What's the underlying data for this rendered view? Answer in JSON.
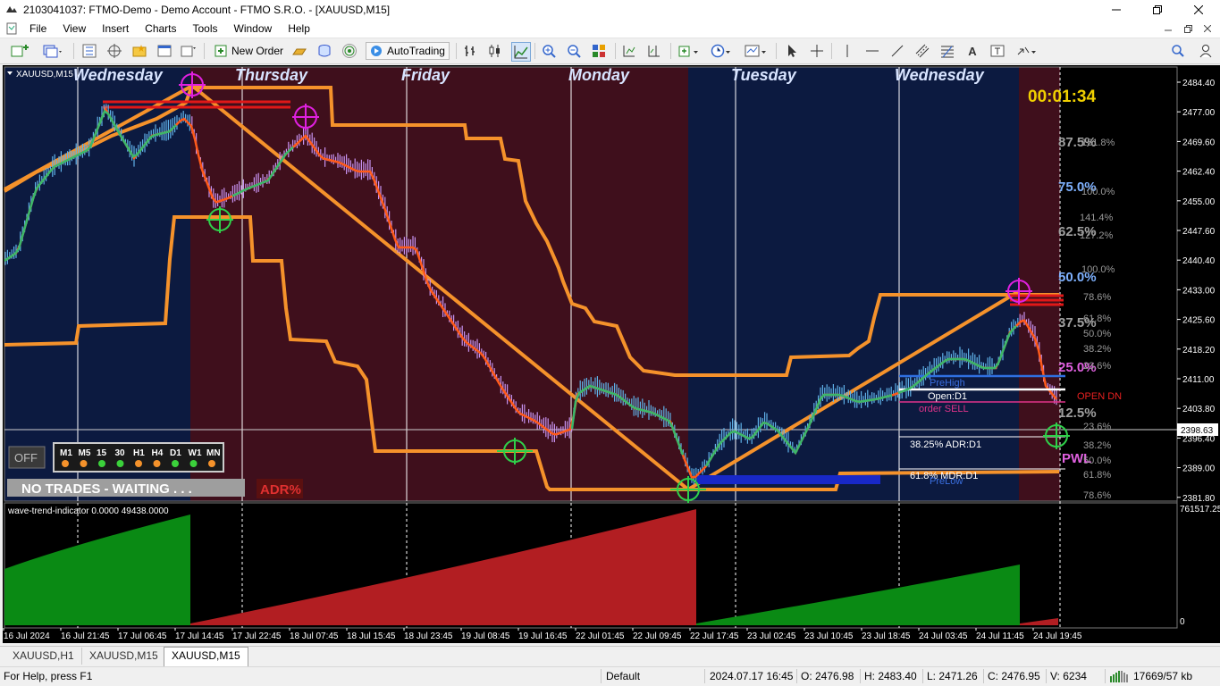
{
  "window": {
    "title": "2103041037: FTMO-Demo - Demo Account - FTMO S.R.O. - [XAUUSD,M15]",
    "minimize_icon": "minimize-icon",
    "maximize_icon": "restore-icon",
    "close_icon": "close-icon"
  },
  "menu": [
    "File",
    "View",
    "Insert",
    "Charts",
    "Tools",
    "Window",
    "Help"
  ],
  "toolbar": {
    "new_order_label": "New Order",
    "autotrading_label": "AutoTrading"
  },
  "chart": {
    "symbol_label": "XAUUSD,M15",
    "days": [
      "Wednesday",
      "Thursday",
      "Friday",
      "Monday",
      "Tuesday",
      "Wednesday"
    ],
    "timer": "00:01:34",
    "price_axis": [
      "2484.40",
      "2477.00",
      "2469.60",
      "2462.40",
      "2455.00",
      "2447.60",
      "2440.40",
      "2433.00",
      "2425.60",
      "2418.20",
      "2411.00",
      "2403.80",
      "2396.40",
      "2389.00",
      "2381.80"
    ],
    "current_price": "2398.63",
    "fib_left": [
      "87.5%",
      "75.0%",
      "62.5%",
      "50.0%",
      "37.5%",
      "25.0%",
      "12.5%"
    ],
    "fib_right": [
      "161.8%",
      "100.0%",
      "141.4%",
      "127.2%",
      "100.0%",
      "78.6%",
      "61.8%",
      "50.0%",
      "38.2%",
      "23.6%",
      "23.6%",
      "38.2%",
      "50.0%",
      "61.8%",
      "78.6%"
    ],
    "labels": {
      "prehigh": "PreHigh",
      "open_d1": "Open:D1",
      "order_sell": "order SELL",
      "open_dn": "OPEN DN",
      "adr_d1": "38.25% ADR:D1",
      "mdr_d1": "61.8% MDR:D1",
      "prelow": "PreLow",
      "pwl": "PWL"
    },
    "panel": {
      "off_button": "OFF",
      "timeframes": [
        "M1",
        "M5",
        "15",
        "30",
        "H1",
        "H4",
        "D1",
        "W1",
        "MN"
      ],
      "status": "NO TRADES - WAITING . . .",
      "adr_button": "ADR%",
      "colors": {
        "orange": "#f5922b",
        "green": "#3bd13b"
      }
    },
    "indicator": {
      "label": "wave-trend-indicator 0.0000 49438.0000",
      "scale_top": "761517.25",
      "scale_bottom": "0"
    },
    "time_axis": [
      "16 Jul 2024",
      "16 Jul 21:45",
      "17 Jul 06:45",
      "17 Jul 14:45",
      "17 Jul 22:45",
      "18 Jul 07:45",
      "18 Jul 15:45",
      "18 Jul 23:45",
      "19 Jul 08:45",
      "19 Jul 16:45",
      "22 Jul 01:45",
      "22 Jul 09:45",
      "22 Jul 17:45",
      "23 Jul 02:45",
      "23 Jul 10:45",
      "23 Jul 18:45",
      "24 Jul 03:45",
      "24 Jul 11:45",
      "24 Jul 19:45"
    ]
  },
  "tabs": [
    "XAUUSD,H1",
    "XAUUSD,M15",
    "XAUUSD,M15"
  ],
  "status": {
    "help": "For Help, press F1",
    "profile": "Default",
    "datetime": "2024.07.17 16:45",
    "open": "O: 2476.98",
    "high": "H: 2483.40",
    "low": "L: 2471.26",
    "close": "C: 2476.95",
    "volume": "V: 6234",
    "traffic": "17669/57 kb"
  }
}
